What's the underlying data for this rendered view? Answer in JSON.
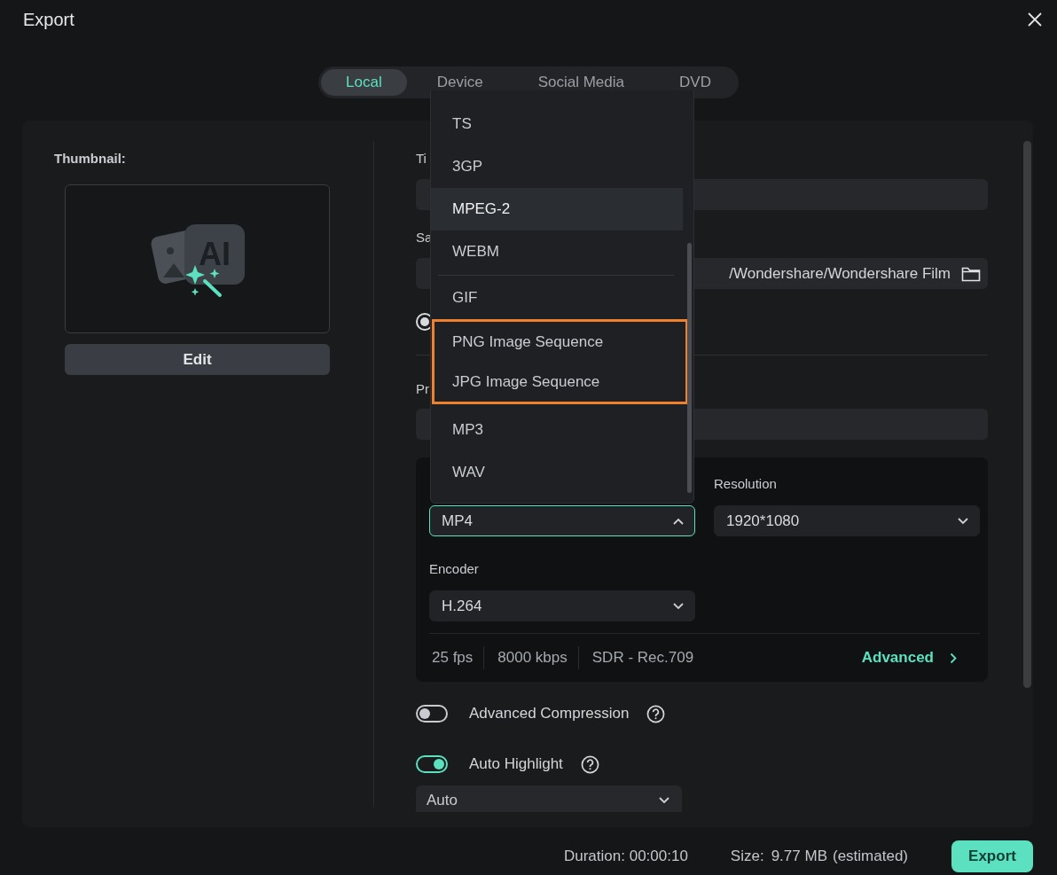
{
  "window": {
    "title": "Export"
  },
  "tabs": [
    {
      "label": "Local",
      "selected": true
    },
    {
      "label": "Device",
      "selected": false
    },
    {
      "label": "Social Media",
      "selected": false
    },
    {
      "label": "DVD",
      "selected": false
    }
  ],
  "thumbnail": {
    "label": "Thumbnail:",
    "badge": "AI",
    "edit_button": "Edit"
  },
  "title_field": {
    "label": "Ti"
  },
  "save_field": {
    "label": "Sa",
    "value": "/Wondershare/Wondershare Film"
  },
  "radio": {
    "checked": true
  },
  "preset_field": {
    "label": "Pr"
  },
  "format_dropdown": {
    "items": [
      {
        "label": "TS",
        "hovered": false,
        "highlighted": false,
        "separator_after": false
      },
      {
        "label": "3GP",
        "hovered": false,
        "highlighted": false,
        "separator_after": false
      },
      {
        "label": "MPEG-2",
        "hovered": true,
        "highlighted": false,
        "separator_after": false
      },
      {
        "label": "WEBM",
        "hovered": false,
        "highlighted": false,
        "separator_after": true
      },
      {
        "label": "GIF",
        "hovered": false,
        "highlighted": false,
        "separator_after": false
      },
      {
        "label": "PNG Image Sequence",
        "hovered": false,
        "highlighted": true,
        "separator_after": false
      },
      {
        "label": "JPG Image Sequence",
        "hovered": false,
        "highlighted": true,
        "separator_after": false
      },
      {
        "label": "MP3",
        "hovered": false,
        "highlighted": false,
        "separator_after": false
      },
      {
        "label": "WAV",
        "hovered": false,
        "highlighted": false,
        "separator_after": false
      }
    ]
  },
  "format_select": {
    "value": "MP4",
    "expanded": true
  },
  "resolution": {
    "label": "Resolution",
    "value": "1920*1080"
  },
  "encoder": {
    "label": "Encoder",
    "value": "H.264"
  },
  "specs": [
    "25 fps",
    "8000 kbps",
    "SDR - Rec.709"
  ],
  "advanced_link": "Advanced",
  "toggles": [
    {
      "label": "Advanced Compression",
      "on": false
    },
    {
      "label": "Auto Highlight",
      "on": true
    }
  ],
  "highlight_select": {
    "value": "Auto"
  },
  "footer": {
    "duration": "Duration: 00:00:10",
    "size_label": "Size:",
    "size_value": "9.77 MB",
    "size_note": "(estimated)",
    "export_button": "Export"
  }
}
